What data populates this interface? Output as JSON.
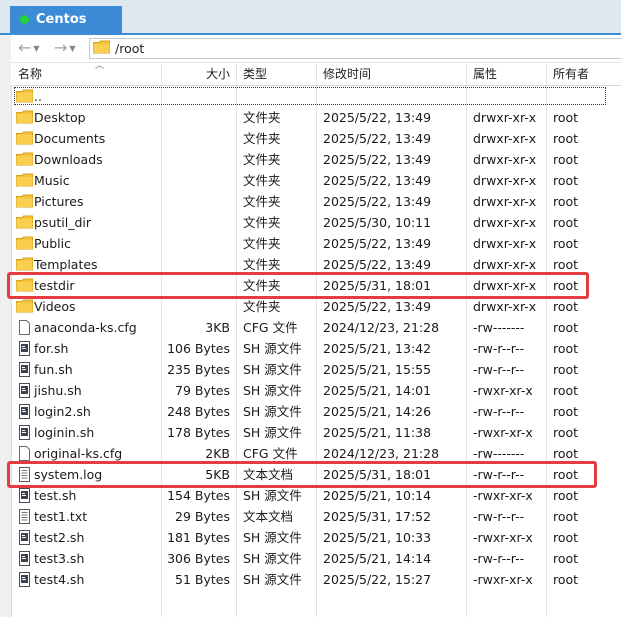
{
  "tab": {
    "title": "Centos"
  },
  "toolbar": {
    "back": "←",
    "forward": "→",
    "path": "/root"
  },
  "columns": {
    "name": "名称",
    "size": "大小",
    "type": "类型",
    "modified": "修改时间",
    "perm": "属性",
    "owner": "所有者"
  },
  "parent": {
    "label": ".."
  },
  "files": [
    {
      "name": "Desktop",
      "size": "",
      "type": "文件夹",
      "modified": "2025/5/22, 13:49",
      "perm": "drwxr-xr-x",
      "owner": "root",
      "icon": "folder-icon"
    },
    {
      "name": "Documents",
      "size": "",
      "type": "文件夹",
      "modified": "2025/5/22, 13:49",
      "perm": "drwxr-xr-x",
      "owner": "root",
      "icon": "folder-icon"
    },
    {
      "name": "Downloads",
      "size": "",
      "type": "文件夹",
      "modified": "2025/5/22, 13:49",
      "perm": "drwxr-xr-x",
      "owner": "root",
      "icon": "folder-icon"
    },
    {
      "name": "Music",
      "size": "",
      "type": "文件夹",
      "modified": "2025/5/22, 13:49",
      "perm": "drwxr-xr-x",
      "owner": "root",
      "icon": "folder-icon"
    },
    {
      "name": "Pictures",
      "size": "",
      "type": "文件夹",
      "modified": "2025/5/22, 13:49",
      "perm": "drwxr-xr-x",
      "owner": "root",
      "icon": "folder-icon"
    },
    {
      "name": "psutil_dir",
      "size": "",
      "type": "文件夹",
      "modified": "2025/5/30, 10:11",
      "perm": "drwxr-xr-x",
      "owner": "root",
      "icon": "folder-icon"
    },
    {
      "name": "Public",
      "size": "",
      "type": "文件夹",
      "modified": "2025/5/22, 13:49",
      "perm": "drwxr-xr-x",
      "owner": "root",
      "icon": "folder-icon"
    },
    {
      "name": "Templates",
      "size": "",
      "type": "文件夹",
      "modified": "2025/5/22, 13:49",
      "perm": "drwxr-xr-x",
      "owner": "root",
      "icon": "folder-icon"
    },
    {
      "name": "testdir",
      "size": "",
      "type": "文件夹",
      "modified": "2025/5/31, 18:01",
      "perm": "drwxr-xr-x",
      "owner": "root",
      "icon": "folder-icon",
      "highlighted": true
    },
    {
      "name": "Videos",
      "size": "",
      "type": "文件夹",
      "modified": "2025/5/22, 13:49",
      "perm": "drwxr-xr-x",
      "owner": "root",
      "icon": "folder-icon"
    },
    {
      "name": "anaconda-ks.cfg",
      "size": "3KB",
      "type": "CFG 文件",
      "modified": "2024/12/23, 21:28",
      "perm": "-rw-------",
      "owner": "root",
      "icon": "blank-file-icon"
    },
    {
      "name": "for.sh",
      "size": "106 Bytes",
      "type": "SH 源文件",
      "modified": "2025/5/21, 13:42",
      "perm": "-rw-r--r--",
      "owner": "root",
      "icon": "script-file-icon"
    },
    {
      "name": "fun.sh",
      "size": "235 Bytes",
      "type": "SH 源文件",
      "modified": "2025/5/21, 15:55",
      "perm": "-rw-r--r--",
      "owner": "root",
      "icon": "script-file-icon"
    },
    {
      "name": "jishu.sh",
      "size": "79 Bytes",
      "type": "SH 源文件",
      "modified": "2025/5/21, 14:01",
      "perm": "-rwxr-xr-x",
      "owner": "root",
      "icon": "script-file-icon"
    },
    {
      "name": "login2.sh",
      "size": "248 Bytes",
      "type": "SH 源文件",
      "modified": "2025/5/21, 14:26",
      "perm": "-rw-r--r--",
      "owner": "root",
      "icon": "script-file-icon"
    },
    {
      "name": "loginin.sh",
      "size": "178 Bytes",
      "type": "SH 源文件",
      "modified": "2025/5/21, 11:38",
      "perm": "-rwxr-xr-x",
      "owner": "root",
      "icon": "script-file-icon"
    },
    {
      "name": "original-ks.cfg",
      "size": "2KB",
      "type": "CFG 文件",
      "modified": "2024/12/23, 21:28",
      "perm": "-rw-------",
      "owner": "root",
      "icon": "blank-file-icon"
    },
    {
      "name": "system.log",
      "size": "5KB",
      "type": "文本文档",
      "modified": "2025/5/31, 18:01",
      "perm": "-rw-r--r--",
      "owner": "root",
      "icon": "text-file-icon",
      "highlighted": true
    },
    {
      "name": "test.sh",
      "size": "154 Bytes",
      "type": "SH 源文件",
      "modified": "2025/5/21, 10:14",
      "perm": "-rwxr-xr-x",
      "owner": "root",
      "icon": "script-file-icon"
    },
    {
      "name": "test1.txt",
      "size": "29 Bytes",
      "type": "文本文档",
      "modified": "2025/5/31, 17:52",
      "perm": "-rw-r--r--",
      "owner": "root",
      "icon": "text-file-icon"
    },
    {
      "name": "test2.sh",
      "size": "181 Bytes",
      "type": "SH 源文件",
      "modified": "2025/5/21, 10:33",
      "perm": "-rwxr-xr-x",
      "owner": "root",
      "icon": "script-file-icon"
    },
    {
      "name": "test3.sh",
      "size": "306 Bytes",
      "type": "SH 源文件",
      "modified": "2025/5/21, 14:14",
      "perm": "-rw-r--r--",
      "owner": "root",
      "icon": "script-file-icon"
    },
    {
      "name": "test4.sh",
      "size": "51 Bytes",
      "type": "SH 源文件",
      "modified": "2025/5/22, 15:27",
      "perm": "-rwxr-xr-x",
      "owner": "root",
      "icon": "script-file-icon"
    }
  ],
  "colors": {
    "tab": "#3d8ad6",
    "status_dot": "#23d33a",
    "highlight": "#e53c42",
    "folder": "#f5c33b"
  }
}
